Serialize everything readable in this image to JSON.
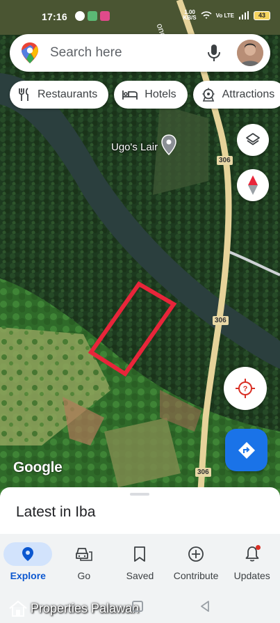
{
  "status_bar": {
    "time": "17:16",
    "net_speed_value": "1.00",
    "net_speed_unit": "KB/S",
    "network_label": "Vo LTE",
    "battery": "43"
  },
  "search": {
    "placeholder": "Search here"
  },
  "chips": [
    {
      "label": "Restaurants",
      "icon": "restaurant-icon"
    },
    {
      "label": "Hotels",
      "icon": "hotel-icon"
    },
    {
      "label": "Attractions",
      "icon": "attractions-icon"
    }
  ],
  "map": {
    "place_label": "Ugo's Lair",
    "road_number": "306",
    "road_name_partial": "ongcolon Ro",
    "logo": "Google",
    "highlight_color": "#e8253a"
  },
  "sheet": {
    "title": "Latest in Iba"
  },
  "nav": [
    {
      "label": "Explore",
      "icon": "explore-icon",
      "active": true
    },
    {
      "label": "Go",
      "icon": "car-icon",
      "active": false
    },
    {
      "label": "Saved",
      "icon": "bookmark-icon",
      "active": false
    },
    {
      "label": "Contribute",
      "icon": "add-circle-icon",
      "active": false
    },
    {
      "label": "Updates",
      "icon": "bell-icon",
      "active": false
    }
  ],
  "watermark": "Properties Palawan",
  "colors": {
    "accent": "#1a73e8",
    "active_nav": "#0b57d0",
    "road": "#e6d39a"
  }
}
